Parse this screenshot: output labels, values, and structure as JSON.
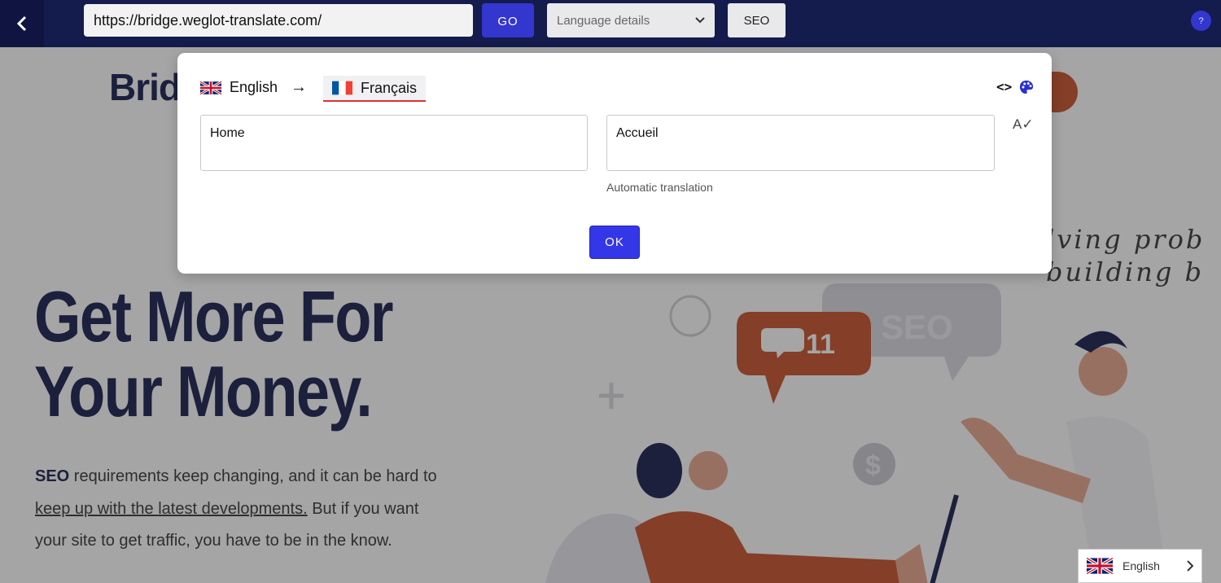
{
  "toolbar": {
    "back_icon": "chevron-left-icon",
    "url": "https://bridge.weglot-translate.com/",
    "go_label": "GO",
    "language_select_value": "Language details",
    "seo_label": "SEO",
    "help_label": "?",
    "colors": {
      "bar": "#141b4d",
      "accent": "#3436d0"
    }
  },
  "page": {
    "brand": "Bridg",
    "hero_title_line1": "Get More For",
    "hero_title_line2": "Your Money.",
    "hero_text_bold": "SEO",
    "hero_text_1": " requirements keep changing, and it can be hard to",
    "hero_text_link": "keep up with the latest developments.",
    "hero_text_2": " But if you want your site to get traffic, you have to be in the know.",
    "illustration_seo": "SEO",
    "illustration_count": "11",
    "illustration_dollar": "$",
    "handwriting_1": "lving prob",
    "handwriting_2": "building b"
  },
  "modal": {
    "source_language": "English",
    "arrow": "→",
    "target_language": "Français",
    "source_text": "Home",
    "target_text": "Accueil",
    "auto_note": "Automatic translation",
    "ok_label": "OK",
    "icons": [
      "code-icon",
      "palette-icon",
      "spellcheck-icon"
    ],
    "colors": {
      "ok": "#3437e8",
      "active_underline": "#e03131"
    }
  },
  "switcher": {
    "language": "English",
    "chevron": "›"
  }
}
